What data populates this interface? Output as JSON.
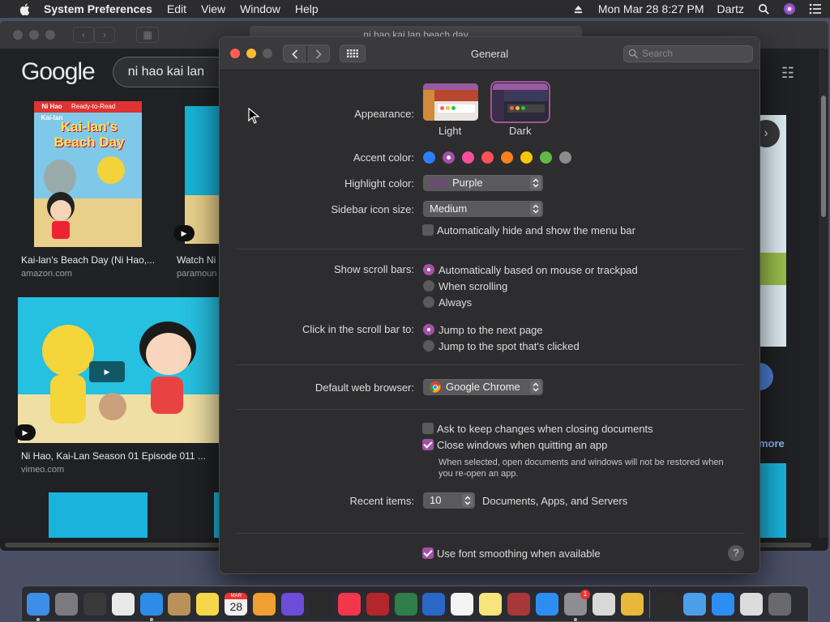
{
  "menubar": {
    "app_name": "System Preferences",
    "menus": [
      "Edit",
      "View",
      "Window",
      "Help"
    ],
    "datetime": "Mon Mar 28  8:27 PM",
    "user": "Dartz"
  },
  "browser": {
    "url": "ni hao kai lan beach day",
    "google_logo": "Google",
    "search_text": "ni hao kai lan",
    "results": [
      {
        "caption": "Kai-lan's Beach Day (Ni Hao,...",
        "source": "amazon.com",
        "book_badge": "Ready-to-Read",
        "book_series": "Ni Hao Kai-lan",
        "book_title": "Kai-lan's Beach Day"
      },
      {
        "caption": "Watch Ni",
        "source": "paramoun"
      },
      {
        "caption": "Ni Hao, Kai-Lan Season 01 Episode 011 ...",
        "source": "vimeo.com"
      }
    ],
    "more_label": "more"
  },
  "prefs": {
    "title": "General",
    "search_placeholder": "Search",
    "appearance": {
      "label": "Appearance:",
      "options": [
        "Light",
        "Dark"
      ],
      "selected": "Dark"
    },
    "accent": {
      "label": "Accent color:",
      "colors": [
        "#2d7ff9",
        "#a550a7",
        "#f74f9e",
        "#ff5257",
        "#f7821b",
        "#ffc600",
        "#62ba46",
        "#8c8c8c"
      ],
      "selected_index": 1
    },
    "highlight": {
      "label": "Highlight color:",
      "value": "Purple"
    },
    "sidebar_icon": {
      "label": "Sidebar icon size:",
      "value": "Medium"
    },
    "auto_hide_menu": {
      "label": "Automatically hide and show the menu bar",
      "checked": false
    },
    "scroll_bars": {
      "label": "Show scroll bars:",
      "options": [
        "Automatically based on mouse or trackpad",
        "When scrolling",
        "Always"
      ],
      "selected_index": 0
    },
    "click_scroll": {
      "label": "Click in the scroll bar to:",
      "options": [
        "Jump to the next page",
        "Jump to the spot that's clicked"
      ],
      "selected_index": 0
    },
    "browser": {
      "label": "Default web browser:",
      "value": "Google Chrome"
    },
    "ask_keep": {
      "label": "Ask to keep changes when closing documents",
      "checked": false
    },
    "close_windows": {
      "label": "Close windows when quitting an app",
      "checked": true
    },
    "close_note": "When selected, open documents and windows will not be restored when you re-open an app.",
    "recent": {
      "label": "Recent items:",
      "value": "10",
      "suffix": "Documents, Apps, and Servers"
    },
    "font_smoothing": {
      "label": "Use font smoothing when available",
      "checked": true
    },
    "help": "?"
  },
  "dock": {
    "calendar_month": "MAR",
    "calendar_day": "28",
    "badge": "1",
    "apps": [
      {
        "name": "finder",
        "color": "#3d8ee6"
      },
      {
        "name": "launchpad",
        "color": "#7a7a80"
      },
      {
        "name": "dashboard",
        "color": "#3a3a3a"
      },
      {
        "name": "chrome",
        "color": "#e9e9e9"
      },
      {
        "name": "safari",
        "color": "#2e8be8"
      },
      {
        "name": "notebook",
        "color": "#b8925a"
      },
      {
        "name": "stickies",
        "color": "#f4d84a"
      },
      {
        "name": "calendar",
        "color": "#f2f2f2"
      },
      {
        "name": "photos",
        "color": "#f0a030"
      },
      {
        "name": "siri",
        "color": "#6c4cd9"
      },
      {
        "name": "grapher",
        "color": "#2a2a2a"
      },
      {
        "name": "news",
        "color": "#f4364c"
      },
      {
        "name": "photo-booth",
        "color": "#b3262a"
      },
      {
        "name": "time-machine",
        "color": "#2f7d48"
      },
      {
        "name": "quicktime",
        "color": "#2a68c8"
      },
      {
        "name": "textedit",
        "color": "#f3f3f3"
      },
      {
        "name": "notes",
        "color": "#f7e47a"
      },
      {
        "name": "dictionary",
        "color": "#a8373a"
      },
      {
        "name": "app-store",
        "color": "#2d8ef2"
      },
      {
        "name": "system-preferences",
        "color": "#8d8d92"
      },
      {
        "name": "script-editor",
        "color": "#d8d8d8"
      },
      {
        "name": "taxi-app",
        "color": "#e8b83a"
      },
      {
        "name": "activity-monitor",
        "color": "#2c2c2c"
      },
      {
        "name": "folder",
        "color": "#4a9fe8"
      },
      {
        "name": "app-store-2",
        "color": "#2d8ef2"
      },
      {
        "name": "preview",
        "color": "#dcdcdc"
      },
      {
        "name": "trash",
        "color": "#6a6a6e"
      }
    ]
  }
}
